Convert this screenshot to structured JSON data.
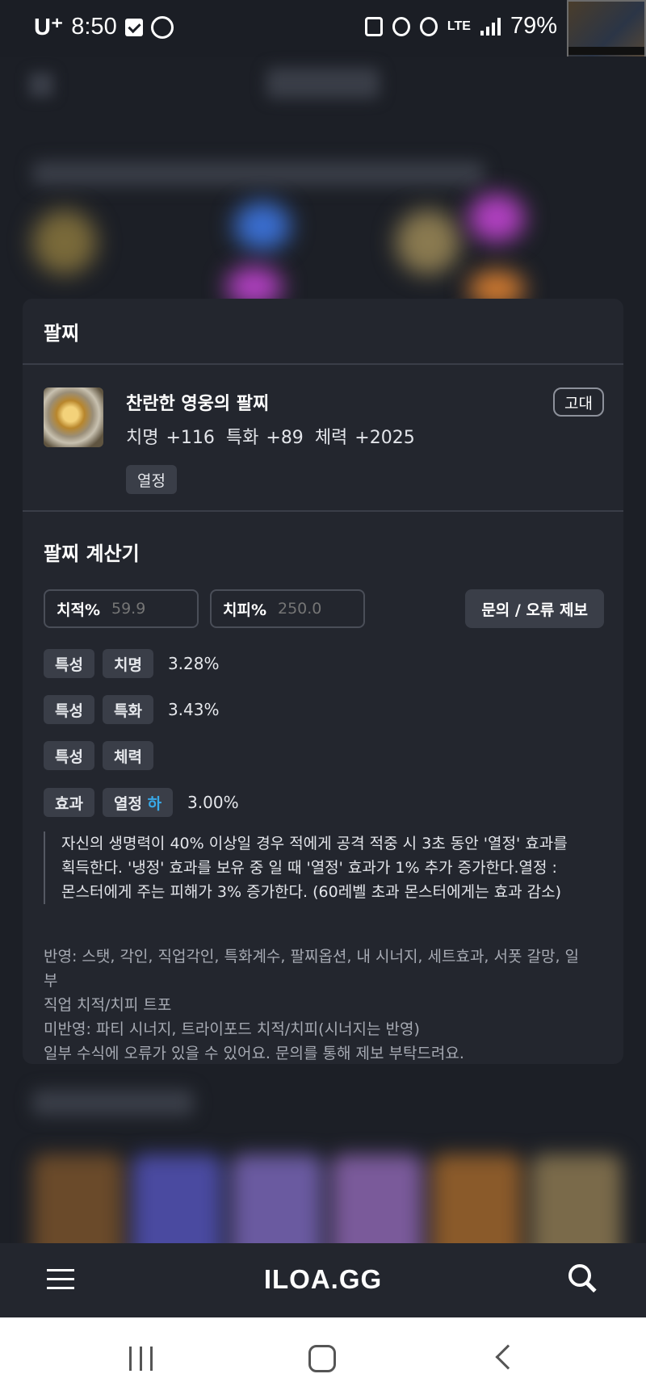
{
  "status_bar": {
    "carrier": "U⁺",
    "time": "8:50",
    "network": "LTE",
    "battery": "79%"
  },
  "modal": {
    "title": "팔찌",
    "item": {
      "name": "찬란한 영웅의 팔찌",
      "grade": "고대",
      "stats": [
        "치명 +116",
        "특화 +89",
        "체력 +2025"
      ],
      "tag": "열정"
    },
    "calculator": {
      "title": "팔찌 계산기",
      "crit_rate_label": "치적%",
      "crit_rate_placeholder": "59.9",
      "crit_dmg_label": "치피%",
      "crit_dmg_placeholder": "250.0",
      "report_button": "문의 / 오류 제보",
      "rows": [
        {
          "type": "특성",
          "stat": "치명",
          "value": "3.28%"
        },
        {
          "type": "특성",
          "stat": "특화",
          "value": "3.43%"
        },
        {
          "type": "특성",
          "stat": "체력",
          "value": ""
        }
      ],
      "effect": {
        "type": "효과",
        "name": "열정",
        "grade": "하",
        "value": "3.00%",
        "description_lines": [
          "자신의 생명력이 40% 이상일 경우 적에게 공격 적중 시 3초 동안 '열정' 효과를",
          "획득한다. '냉정' 효과를 보유 중 일 때 '열정' 효과가 1% 추가 증가한다.열정 :",
          "몬스터에게 주는 피해가 3% 증가한다. (60레벨 초과 몬스터에게는 효과 감소)"
        ]
      },
      "notes": [
        "반영: 스탯, 각인, 직업각인, 특화계수, 팔찌옵션, 내 시너지, 세트효과, 서폿 갈망, 일부",
        "직업 치적/치피 트포",
        "미반영: 파티 시너지, 트라이포드 치적/치피(시너지는 반영)",
        "일부 수식에 오류가 있을 수 있어요. 문의를 통해 제보 부탁드려요."
      ]
    }
  },
  "bottom_bar": {
    "logo": "ILOA.GG"
  },
  "colors": {
    "background": "#1c1f26",
    "card": "#23262e",
    "chip": "#3a3e48",
    "accent": "#38a9e8"
  }
}
